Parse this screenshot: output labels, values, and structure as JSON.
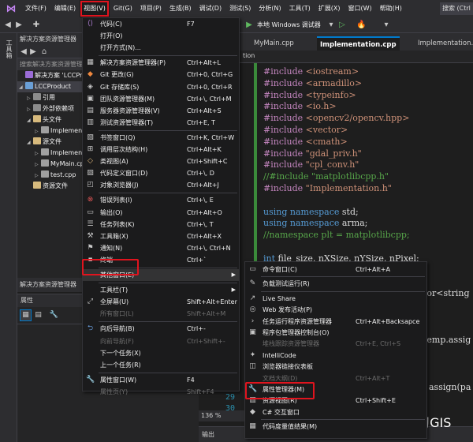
{
  "menubar": {
    "items": [
      "文件(F)",
      "编辑(E)",
      "视图(V)",
      "Git(G)",
      "项目(P)",
      "生成(B)",
      "调试(D)",
      "测试(S)",
      "分析(N)",
      "工具(T)",
      "扩展(X)",
      "窗口(W)",
      "帮助(H)"
    ],
    "search": "搜索 (Ctrl"
  },
  "toolbar": {
    "debugger": "本地 Windows 调试器"
  },
  "rail": {
    "label": "工具箱"
  },
  "solution_explorer": {
    "title": "解决方案资源管理器",
    "search": "搜索解决方案资源管理器",
    "items": [
      {
        "text": "解决方案 'LCCProduct'",
        "depth": 0,
        "arrow": "",
        "color": "#9b6cd6"
      },
      {
        "text": "LCCProduct",
        "depth": 0,
        "arrow": "◢",
        "color": "#6a9fd6"
      },
      {
        "text": "引用",
        "depth": 1,
        "arrow": "▷",
        "color": "#8c8c8c"
      },
      {
        "text": "外部依赖项",
        "depth": 1,
        "arrow": "▷",
        "color": "#8c8c8c"
      },
      {
        "text": "头文件",
        "depth": 1,
        "arrow": "◢",
        "color": "#d7ba7d"
      },
      {
        "text": "Implementation.h",
        "depth": 2,
        "arrow": "▷",
        "color": "#a0a0a0"
      },
      {
        "text": "源文件",
        "depth": 1,
        "arrow": "◢",
        "color": "#d7ba7d"
      },
      {
        "text": "Implementation.cpp",
        "depth": 2,
        "arrow": "▷",
        "color": "#a0a0a0"
      },
      {
        "text": "MyMain.cpp",
        "depth": 2,
        "arrow": "▷",
        "color": "#a0a0a0"
      },
      {
        "text": "test.cpp",
        "depth": 2,
        "arrow": "▷",
        "color": "#a0a0a0"
      },
      {
        "text": "资源文件",
        "depth": 1,
        "arrow": "",
        "color": "#d7ba7d"
      }
    ]
  },
  "class_view": {
    "title": "解决方案资源管理器"
  },
  "properties": {
    "title": "属性"
  },
  "editor": {
    "tabs": [
      "MyMain.cpp",
      "Implementation.cpp",
      "Implementation.h"
    ],
    "nav_text": "tion",
    "zoom": "136 %",
    "output_label": "输出",
    "line_numbers": [
      "29",
      "30"
    ],
    "code": [
      [
        {
          "t": "#include ",
          "c": "pp"
        },
        {
          "t": "<iostream>",
          "c": "str"
        }
      ],
      [
        {
          "t": "#include ",
          "c": "pp"
        },
        {
          "t": "<armadillo>",
          "c": "str"
        }
      ],
      [
        {
          "t": "#include ",
          "c": "pp"
        },
        {
          "t": "<typeinfo>",
          "c": "str"
        }
      ],
      [
        {
          "t": "#include ",
          "c": "pp"
        },
        {
          "t": "<io.h>",
          "c": "str"
        }
      ],
      [
        {
          "t": "#include ",
          "c": "pp"
        },
        {
          "t": "<opencv2/opencv.hpp>",
          "c": "str"
        }
      ],
      [
        {
          "t": "#include ",
          "c": "pp"
        },
        {
          "t": "<vector>",
          "c": "str"
        }
      ],
      [
        {
          "t": "#include ",
          "c": "pp"
        },
        {
          "t": "<cmath>",
          "c": "str"
        }
      ],
      [
        {
          "t": "#include ",
          "c": "pp"
        },
        {
          "t": "\"gdal_priv.h\"",
          "c": "str"
        }
      ],
      [
        {
          "t": "#include ",
          "c": "pp"
        },
        {
          "t": "\"cpl_conv.h\"",
          "c": "str"
        }
      ],
      [
        {
          "t": "//#include \"matplotlibcpp.h\"",
          "c": "cm"
        }
      ],
      [
        {
          "t": "#include ",
          "c": "pp"
        },
        {
          "t": "\"Implementation.h\"",
          "c": "str"
        }
      ],
      [],
      [
        {
          "t": "using namespace ",
          "c": "kw"
        },
        {
          "t": "std;",
          "c": "txt"
        }
      ],
      [
        {
          "t": "using namespace ",
          "c": "kw"
        },
        {
          "t": "arma;",
          "c": "txt"
        }
      ],
      [
        {
          "t": "//namespace plt = matplotlibcpp;",
          "c": "cm"
        }
      ],
      [],
      [
        {
          "t": "int ",
          "c": "kw"
        },
        {
          "t": "file_size, nXSize, nYSize, nPixel;",
          "c": "txt"
        }
      ],
      [],
      [],
      [
        {
          "t": "tor<string",
          "c": "txt"
        }
      ],
      [],
      [],
      [],
      [
        {
          "t": "temp.assig",
          "c": "txt"
        }
      ],
      [],
      [],
      [],
      [
        {
          "t": "assign(pa",
          "c": "txt"
        }
      ]
    ]
  },
  "view_menu": {
    "items": [
      {
        "icon": "code-icon",
        "glyph": "⟨⟩",
        "color": "#b180d7",
        "label": "代码(C)",
        "shortcut": "F7"
      },
      {
        "icon": "open-icon",
        "glyph": "",
        "color": "#c8c8c8",
        "label": "打开(O)",
        "shortcut": ""
      },
      {
        "icon": "",
        "glyph": "",
        "color": "",
        "label": "打开方式(N)...",
        "shortcut": ""
      },
      {
        "sep": true
      },
      {
        "icon": "solution-explorer-icon",
        "glyph": "▦",
        "color": "#c8c8c8",
        "label": "解决方案资源管理器(P)",
        "shortcut": "Ctrl+Alt+L"
      },
      {
        "icon": "git-changes-icon",
        "glyph": "◆",
        "color": "#f0883e",
        "label": "Git 更改(G)",
        "shortcut": "Ctrl+0, Ctrl+G"
      },
      {
        "icon": "git-repository-icon",
        "glyph": "◈",
        "color": "#c8c8c8",
        "label": "Git 存储库(S)",
        "shortcut": "Ctrl+0, Ctrl+R"
      },
      {
        "icon": "team-explorer-icon",
        "glyph": "▣",
        "color": "#c8c8c8",
        "label": "团队资源管理器(M)",
        "shortcut": "Ctrl+\\, Ctrl+M"
      },
      {
        "icon": "server-explorer-icon",
        "glyph": "▤",
        "color": "#c8c8c8",
        "label": "服务器资源管理器(V)",
        "shortcut": "Ctrl+Alt+S"
      },
      {
        "icon": "test-explorer-icon",
        "glyph": "▥",
        "color": "#c8c8c8",
        "label": "测试资源管理器(T)",
        "shortcut": "Ctrl+E, T"
      },
      {
        "sep": true
      },
      {
        "icon": "bookmark-window-icon",
        "glyph": "▧",
        "color": "#c8c8c8",
        "label": "书签窗口(Q)",
        "shortcut": "Ctrl+K, Ctrl+W"
      },
      {
        "icon": "call-hierarchy-icon",
        "glyph": "⊞",
        "color": "#c8c8c8",
        "label": "调用层次结构(H)",
        "shortcut": "Ctrl+Alt+K"
      },
      {
        "icon": "class-view-icon",
        "glyph": "◇",
        "color": "#dcb67a",
        "label": "类视图(A)",
        "shortcut": "Ctrl+Shift+C"
      },
      {
        "icon": "code-definition-icon",
        "glyph": "▨",
        "color": "#c8c8c8",
        "label": "代码定义窗口(D)",
        "shortcut": "Ctrl+\\, D"
      },
      {
        "icon": "object-browser-icon",
        "glyph": "◰",
        "color": "#c8c8c8",
        "label": "对象浏览器(J)",
        "shortcut": "Ctrl+Alt+J"
      },
      {
        "sep": true
      },
      {
        "icon": "error-list-icon",
        "glyph": "⊗",
        "color": "#e05555",
        "label": "错误列表(I)",
        "shortcut": "Ctrl+\\, E"
      },
      {
        "icon": "output-icon",
        "glyph": "▭",
        "color": "#c8c8c8",
        "label": "输出(O)",
        "shortcut": "Ctrl+Alt+O"
      },
      {
        "icon": "task-list-icon",
        "glyph": "☰",
        "color": "#c8c8c8",
        "label": "任务列表(K)",
        "shortcut": "Ctrl+\\, T"
      },
      {
        "icon": "toolbox-icon",
        "glyph": "⚒",
        "color": "#c8c8c8",
        "label": "工具箱(X)",
        "shortcut": "Ctrl+Alt+X"
      },
      {
        "icon": "notifications-icon",
        "glyph": "⚑",
        "color": "#c8c8c8",
        "label": "通知(N)",
        "shortcut": "Ctrl+\\, Ctrl+N"
      },
      {
        "icon": "terminal-icon",
        "glyph": "▪",
        "color": "#c8c8c8",
        "label": "终端",
        "shortcut": "Ctrl+`"
      },
      {
        "sep": true
      },
      {
        "icon": "",
        "glyph": "",
        "color": "",
        "label": "其他窗口(E)",
        "shortcut": "",
        "submenu": true,
        "highlight": true
      },
      {
        "sep": true
      },
      {
        "icon": "",
        "glyph": "",
        "color": "",
        "label": "工具栏(T)",
        "shortcut": "",
        "submenu": true
      },
      {
        "icon": "fullscreen-icon",
        "glyph": "⤢",
        "color": "#c8c8c8",
        "label": "全屏幕(U)",
        "shortcut": "Shift+Alt+Enter"
      },
      {
        "icon": "all-windows-icon",
        "glyph": "",
        "color": "#6d6d6d",
        "label": "所有窗口(L)",
        "shortcut": "Shift+Alt+M",
        "disabled": true
      },
      {
        "sep": true
      },
      {
        "icon": "navigate-backward-icon",
        "glyph": "⮌",
        "color": "#6aa0e0",
        "label": "向后导航(B)",
        "shortcut": "Ctrl+-"
      },
      {
        "icon": "navigate-forward-icon",
        "glyph": "",
        "color": "#6d6d6d",
        "label": "向前导航(F)",
        "shortcut": "Ctrl+Shift+-",
        "disabled": true
      },
      {
        "icon": "",
        "glyph": "",
        "color": "",
        "label": "下一个任务(X)",
        "shortcut": ""
      },
      {
        "icon": "",
        "glyph": "",
        "color": "",
        "label": "上一个任务(R)",
        "shortcut": ""
      },
      {
        "sep": true
      },
      {
        "icon": "properties-window-icon",
        "glyph": "🔧",
        "color": "#c8c8c8",
        "label": "属性窗口(W)",
        "shortcut": "F4"
      },
      {
        "icon": "",
        "glyph": "",
        "color": "",
        "label": "属性页(Y)",
        "shortcut": "Shift+F4",
        "disabled": true
      }
    ]
  },
  "other_windows_menu": {
    "items": [
      {
        "icon": "command-window-icon",
        "glyph": "▭",
        "color": "#c8c8c8",
        "label": "命令窗口(C)",
        "shortcut": "Ctrl+Alt+A"
      },
      {
        "sep": true
      },
      {
        "icon": "load-test-icon",
        "glyph": "✎",
        "color": "#c8c8c8",
        "label": "负载测试运行(R)",
        "shortcut": ""
      },
      {
        "sep": true
      },
      {
        "icon": "live-share-icon",
        "glyph": "↗",
        "color": "#c8c8c8",
        "label": "Live Share",
        "shortcut": ""
      },
      {
        "icon": "web-publish-icon",
        "glyph": "◎",
        "color": "#c8c8c8",
        "label": "Web 发布活动(P)",
        "shortcut": ""
      },
      {
        "icon": "task-runner-icon",
        "glyph": "›",
        "color": "#c8c8c8",
        "label": "任务运行程序资源管理器",
        "shortcut": "Ctrl+Alt+Backsapce"
      },
      {
        "icon": "package-manager-icon",
        "glyph": "▣",
        "color": "#c8c8c8",
        "label": "程序包管理器控制台(O)",
        "shortcut": ""
      },
      {
        "icon": "",
        "glyph": "",
        "color": "",
        "label": "堆栈跟踪资源管理器",
        "shortcut": "Ctrl+E, Ctrl+S",
        "disabled": true
      },
      {
        "icon": "intellicode-icon",
        "glyph": "✦",
        "color": "#c8c8c8",
        "label": "IntelliCode",
        "shortcut": ""
      },
      {
        "icon": "browser-link-icon",
        "glyph": "◫",
        "color": "#c8c8c8",
        "label": "浏览器链接仪表板",
        "shortcut": ""
      },
      {
        "icon": "",
        "glyph": "",
        "color": "",
        "label": "文档大纲(D)",
        "shortcut": "Ctrl+Alt+T",
        "disabled": true
      },
      {
        "icon": "property-manager-icon",
        "glyph": "🔧",
        "color": "#c8c8c8",
        "label": "属性管理器(M)",
        "shortcut": "",
        "highlight": true
      },
      {
        "icon": "resource-view-icon",
        "glyph": "▥",
        "color": "#c8c8c8",
        "label": "资源视图(R)",
        "shortcut": "Ctrl+Shift+E"
      },
      {
        "icon": "csharp-interactive-icon",
        "glyph": "◆",
        "color": "#c8c8c8",
        "label": "C# 交互窗口",
        "shortcut": ""
      },
      {
        "sep": true
      },
      {
        "icon": "code-metrics-icon",
        "glyph": "▦",
        "color": "#c8c8c8",
        "label": "代码度量值结果(M)",
        "shortcut": ""
      }
    ]
  },
  "watermark": "知乎 @疯狂学习GIS"
}
